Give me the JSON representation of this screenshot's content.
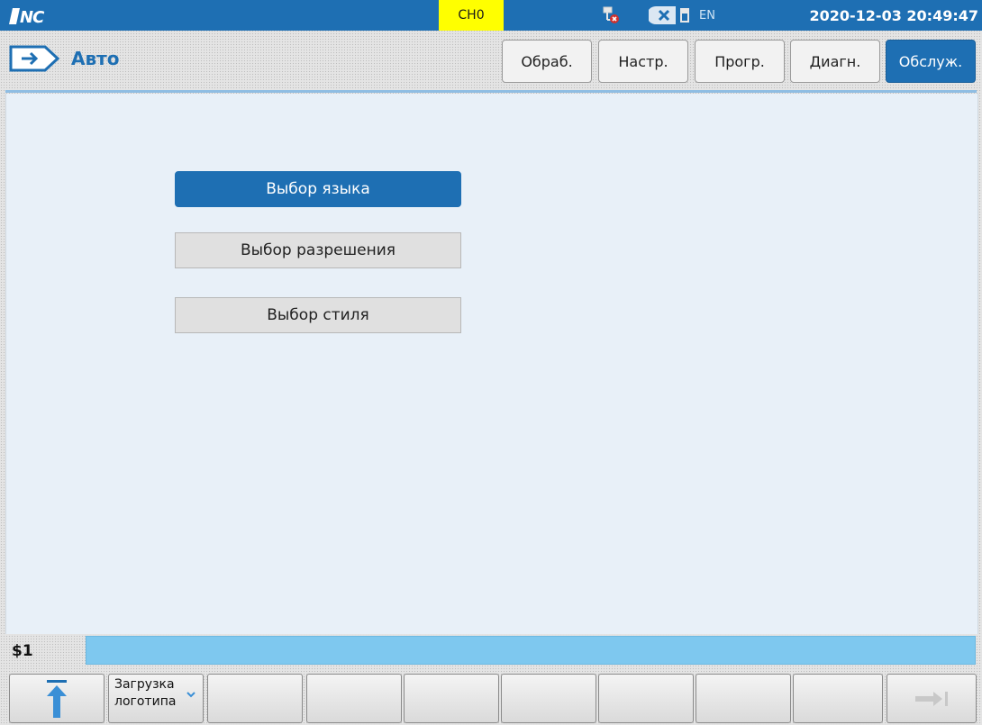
{
  "status_bar": {
    "channel": "CH0",
    "language": "EN",
    "datetime": "2020-12-03 20:49:47"
  },
  "mode": {
    "label": "Авто"
  },
  "nav_tabs": [
    {
      "label": "Обраб.",
      "active": false
    },
    {
      "label": "Настр.",
      "active": false
    },
    {
      "label": "Прогр.",
      "active": false
    },
    {
      "label": "Диагн.",
      "active": false
    },
    {
      "label": "Обслуж.",
      "active": true
    }
  ],
  "menu": {
    "options": [
      {
        "label": "Выбор языка",
        "selected": true
      },
      {
        "label": "Выбор разрешения",
        "selected": false
      },
      {
        "label": "Выбор стиля",
        "selected": false
      }
    ]
  },
  "command": {
    "prefix": "$1",
    "value": ""
  },
  "softkeys": {
    "logo_load_line1": "Загрузка",
    "logo_load_line2": "логотипа"
  },
  "colors": {
    "accent": "#1e6fb3",
    "channel_bg": "#ffff00",
    "command_field": "#7ec8ef"
  }
}
